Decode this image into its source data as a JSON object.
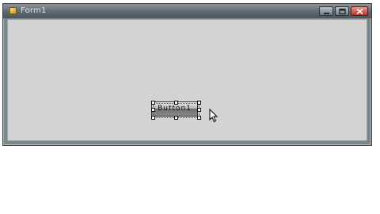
{
  "window": {
    "title": "Form1",
    "controls": {
      "minimize_icon": "minimize-icon",
      "maximize_icon": "maximize-icon",
      "close_icon": "close-icon"
    }
  },
  "designer": {
    "button": {
      "label": "Button1"
    }
  },
  "colors": {
    "client_background": "#d3d3d3",
    "titlebar": "#5f686d",
    "close_button": "#b4352a"
  }
}
